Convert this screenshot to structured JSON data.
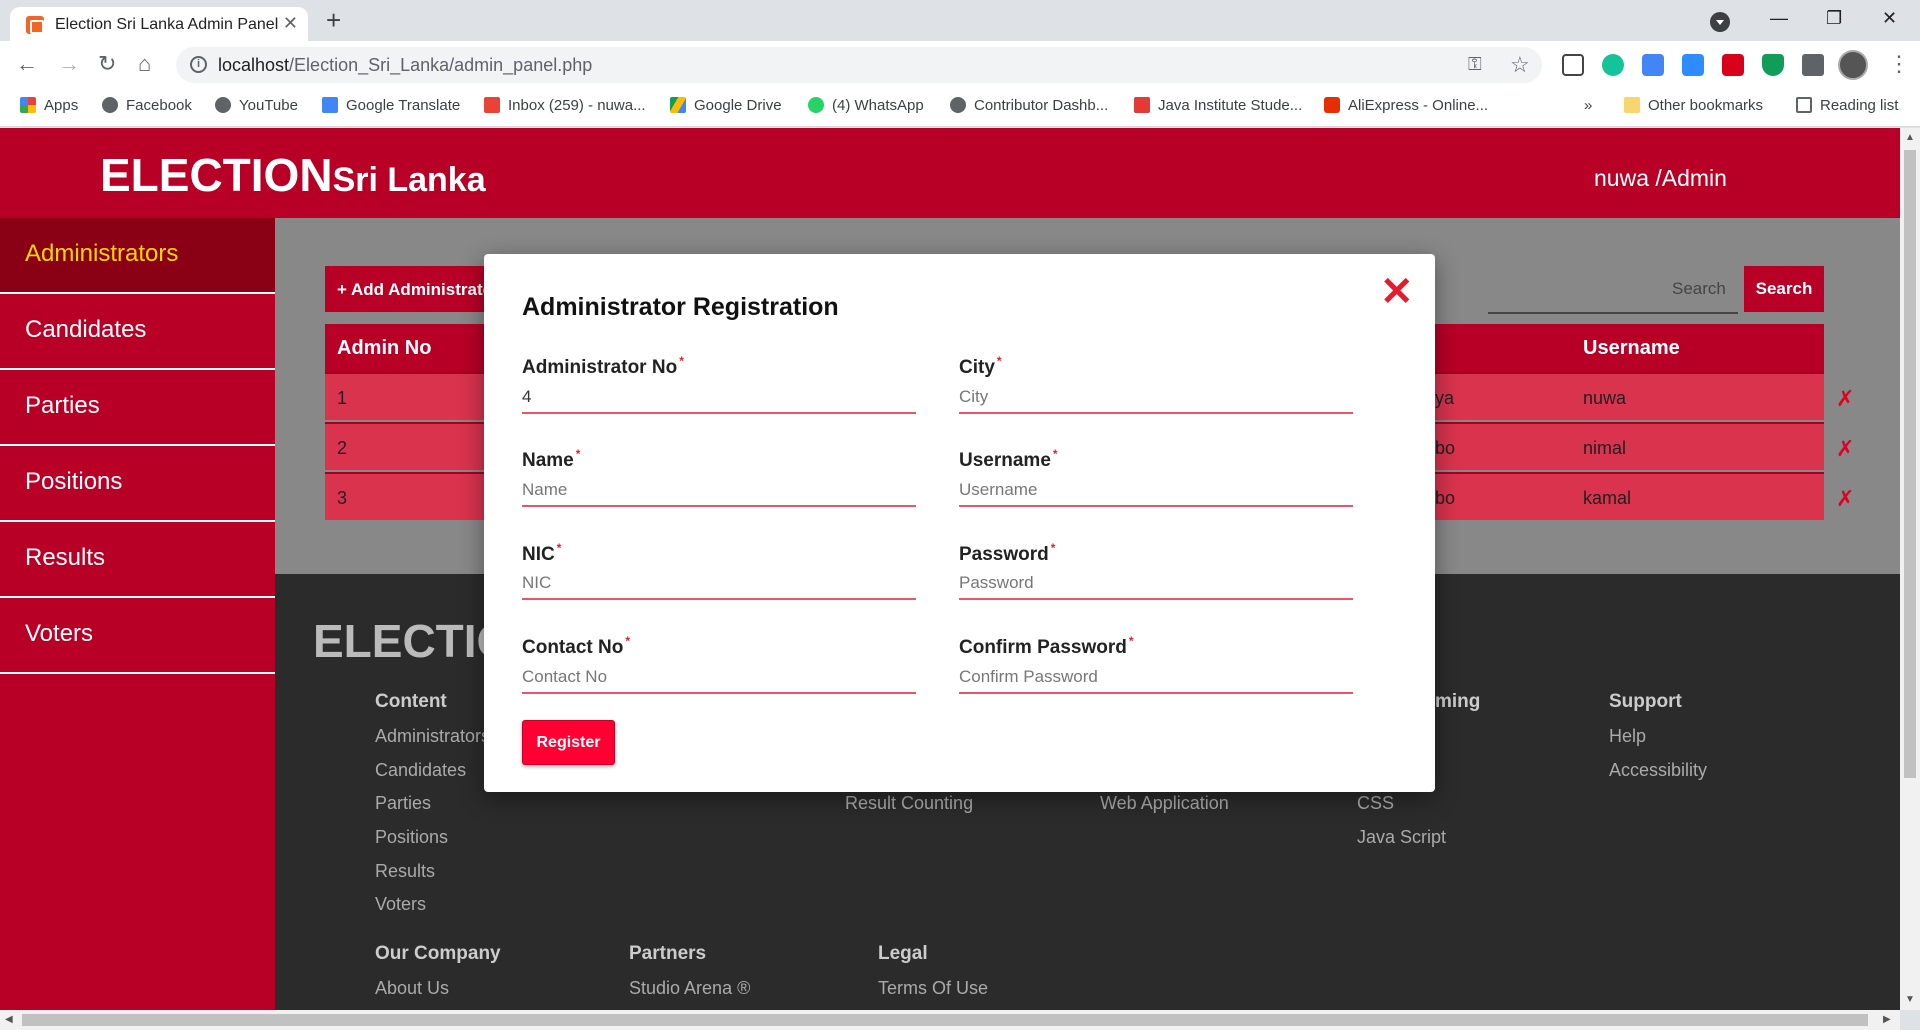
{
  "browser": {
    "tab_title": "Election Sri Lanka Admin Panel",
    "url_host": "localhost",
    "url_path": "/Election_Sri_Lanka/admin_panel.php",
    "bookmarks": [
      "Apps",
      "Facebook",
      "YouTube",
      "Google Translate",
      "Inbox (259) - nuwa...",
      "Google Drive",
      "(4) WhatsApp",
      "Contributor Dashb...",
      "Java Institute Stude...",
      "AliExpress - Online..."
    ],
    "other_bookmarks": "Other bookmarks",
    "reading_list": "Reading list"
  },
  "header": {
    "brand_main": "ELECTION",
    "brand_sub": "Sri Lanka",
    "user": "nuwa /Admin"
  },
  "sidebar": {
    "items": [
      {
        "label": "Administrators"
      },
      {
        "label": "Candidates"
      },
      {
        "label": "Parties"
      },
      {
        "label": "Positions"
      },
      {
        "label": "Results"
      },
      {
        "label": "Voters"
      }
    ]
  },
  "toolbar": {
    "add_label": "+ Add Administrator",
    "search_placeholder": "Search",
    "search_label": "Search"
  },
  "table": {
    "headers": {
      "admin_no": "Admin No",
      "username": "Username"
    },
    "rows": [
      {
        "no": "1",
        "city_partial": "ya",
        "username": "nuwa",
        "delete": "✗"
      },
      {
        "no": "2",
        "city_partial": "bo",
        "username": "nimal",
        "delete": "✗"
      },
      {
        "no": "3",
        "city_partial": "bo",
        "username": "kamal",
        "delete": "✗"
      }
    ]
  },
  "footer": {
    "brand": "ELECTION",
    "content_head": "Content",
    "content_links": [
      "Administrators",
      "Candidates",
      "Parties",
      "Positions",
      "Results",
      "Voters"
    ],
    "col2_link": "Result Counting",
    "col3_link": "Web Application",
    "programming_head_partial": "ming",
    "programming_links": [
      "CSS",
      "Java Script"
    ],
    "support_head": "Support",
    "support_links": [
      "Help",
      "Accessibility"
    ],
    "company_head": "Our Company",
    "company_link": "About Us",
    "partners_head": "Partners",
    "partners_link": "Studio Arena ®",
    "legal_head": "Legal",
    "legal_link": "Terms Of Use"
  },
  "modal": {
    "title": "Administrator Registration",
    "close": "✕",
    "fields": {
      "admin_no": {
        "label": "Administrator No",
        "value": "4",
        "placeholder": ""
      },
      "name": {
        "label": "Name",
        "value": "",
        "placeholder": "Name"
      },
      "nic": {
        "label": "NIC",
        "value": "",
        "placeholder": "NIC"
      },
      "contact": {
        "label": "Contact No",
        "value": "",
        "placeholder": "Contact No"
      },
      "city": {
        "label": "City",
        "value": "",
        "placeholder": "City"
      },
      "username": {
        "label": "Username",
        "value": "",
        "placeholder": "Username"
      },
      "password": {
        "label": "Password",
        "value": "",
        "placeholder": "Password"
      },
      "confirm": {
        "label": "Confirm Password",
        "value": "",
        "placeholder": "Confirm Password"
      }
    },
    "register_label": "Register",
    "required_mark": "*"
  }
}
